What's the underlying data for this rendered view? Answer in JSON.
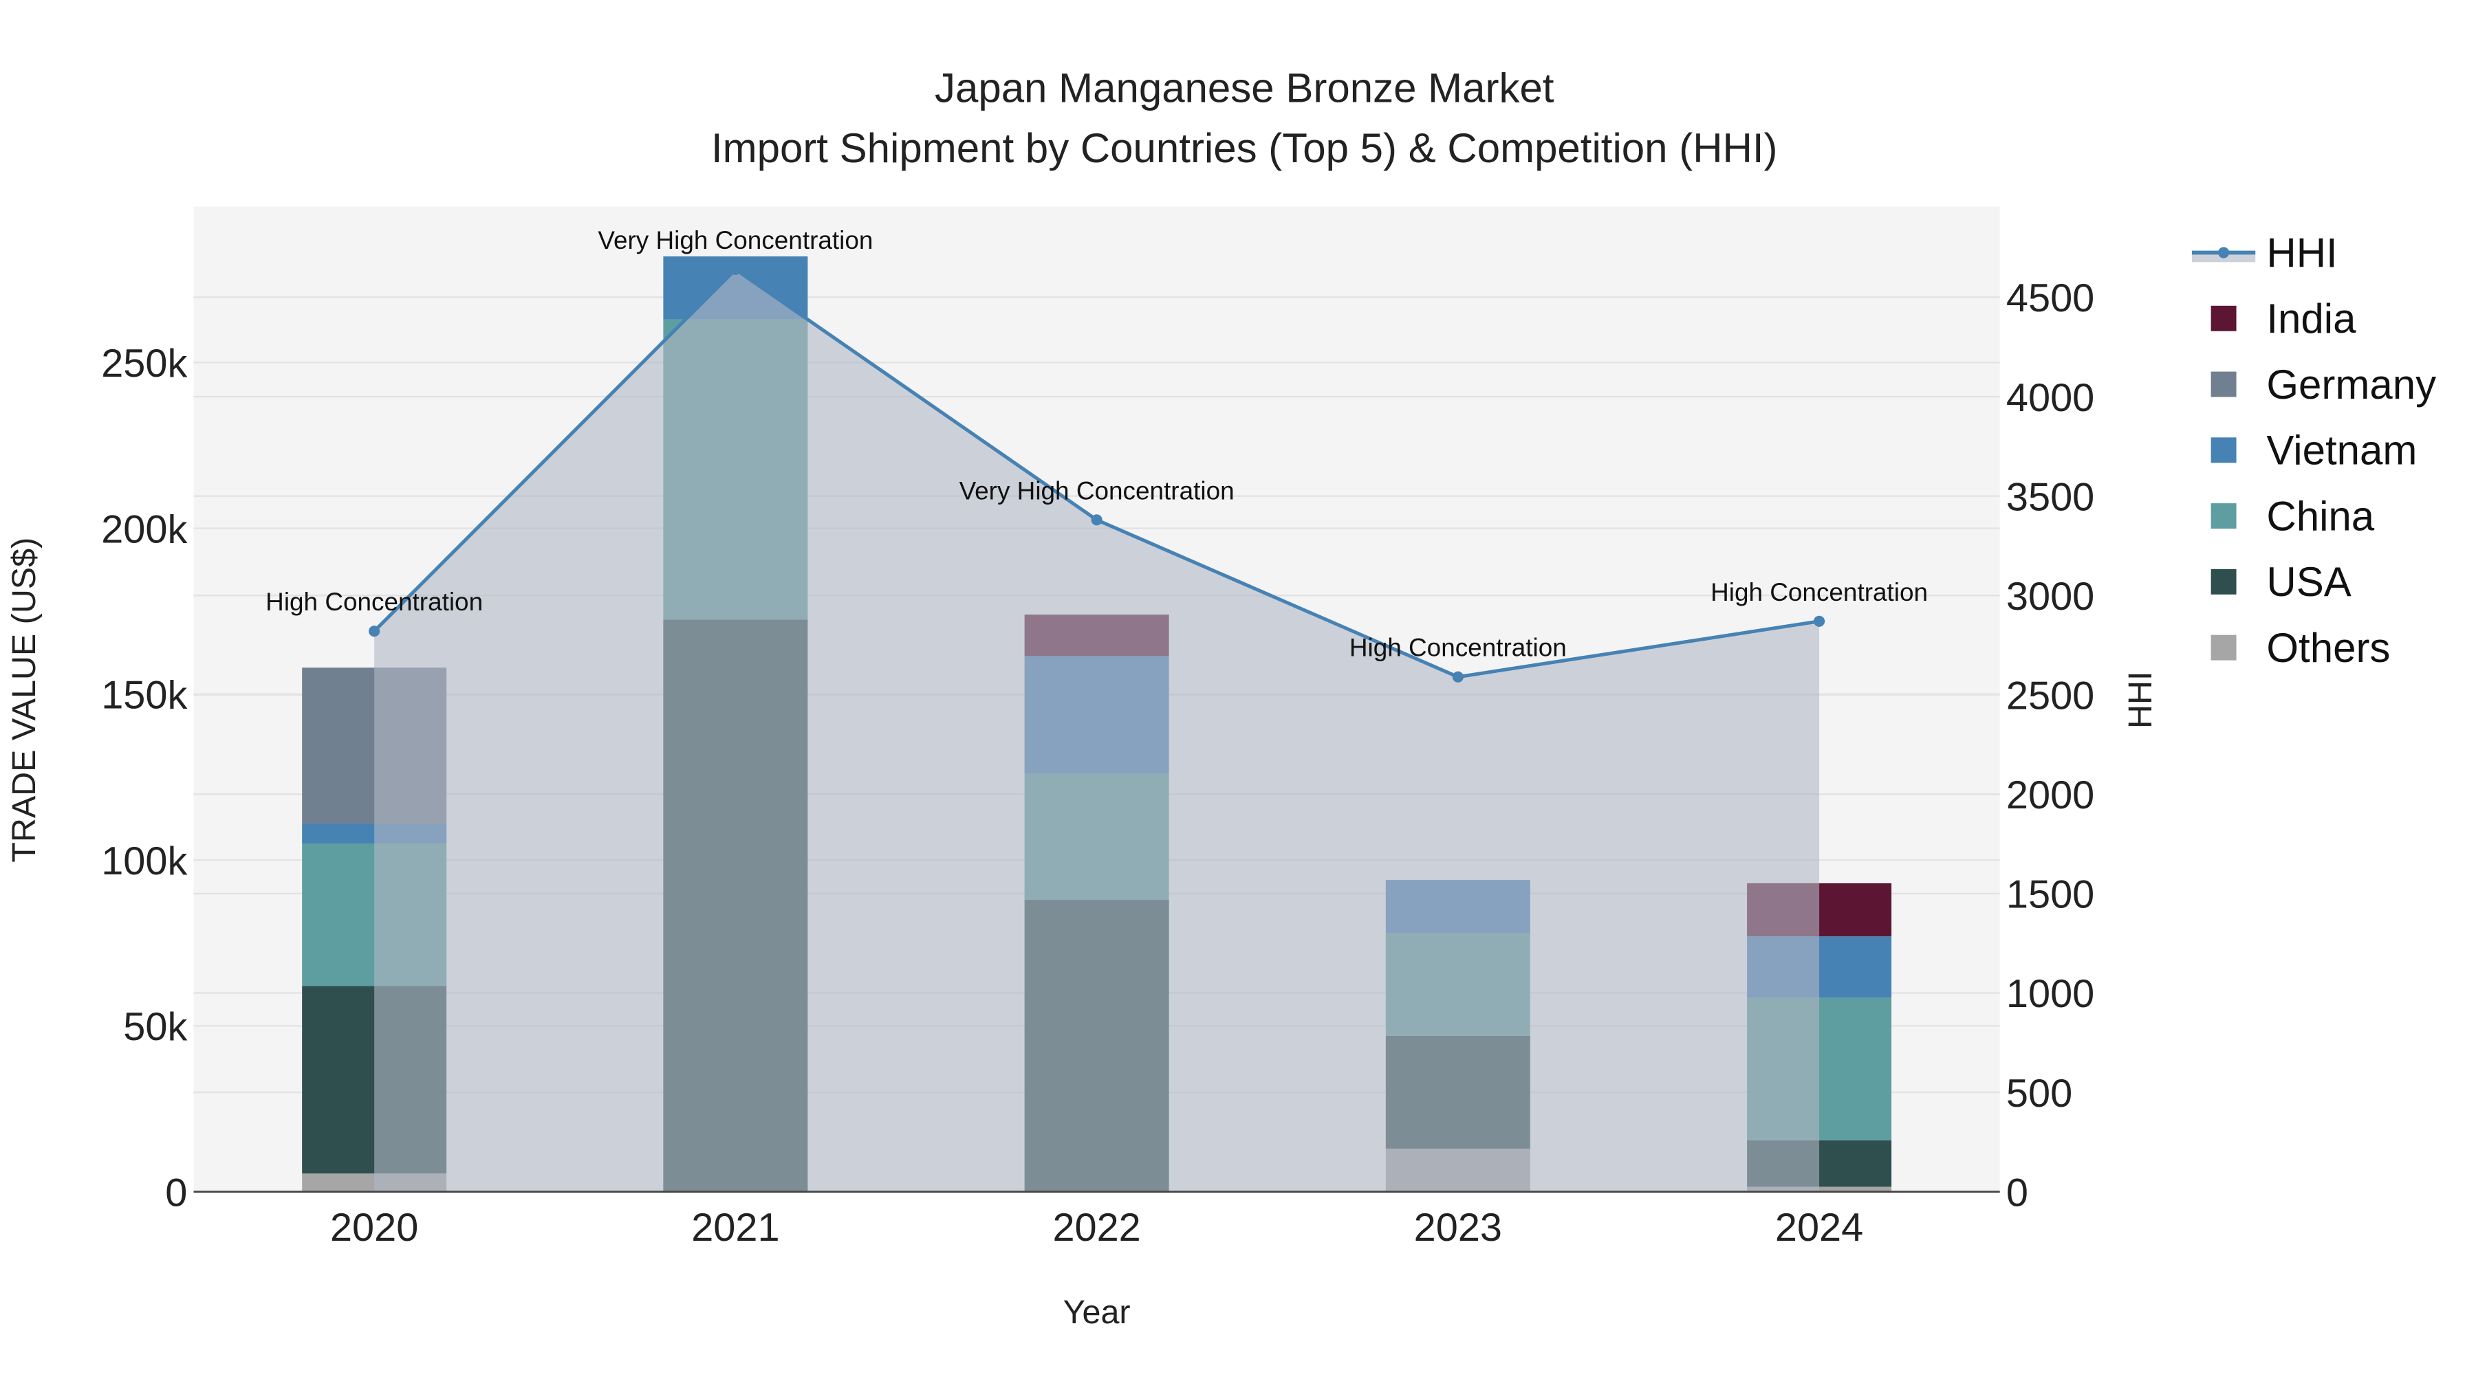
{
  "chart_data": {
    "type": "bar",
    "stacked": true,
    "title_line1": "Japan Manganese Bronze Market",
    "title_line2": "Import Shipment by Countries (Top 5) & Competition (HHI)",
    "xlabel": "Year",
    "ylabel": "TRADE VALUE (US$)",
    "y2label": "HHI",
    "categories": [
      "2020",
      "2021",
      "2022",
      "2023",
      "2024"
    ],
    "ylim": [
      0,
      297000
    ],
    "y2lim": [
      0,
      4956
    ],
    "yticks": [
      0,
      50000,
      100000,
      150000,
      200000,
      250000
    ],
    "ytick_labels": [
      "0",
      "50k",
      "100k",
      "150k",
      "200k",
      "250k"
    ],
    "y2ticks": [
      0,
      500,
      1000,
      1500,
      2000,
      2500,
      3000,
      3500,
      4000,
      4500
    ],
    "y2tick_labels": [
      "0",
      "500",
      "1000",
      "1500",
      "2000",
      "2500",
      "3000",
      "3500",
      "4000",
      "4500"
    ],
    "series": [
      {
        "name": "Others",
        "color": "#a6a6a6",
        "values": [
          5500,
          0,
          0,
          13000,
          1500
        ]
      },
      {
        "name": "USA",
        "color": "#2f4f4f",
        "values": [
          56500,
          172500,
          88000,
          34000,
          14000
        ]
      },
      {
        "name": "China",
        "color": "#5f9ea0",
        "values": [
          43000,
          90500,
          38000,
          31000,
          43000
        ]
      },
      {
        "name": "Vietnam",
        "color": "#4682b4",
        "values": [
          6000,
          19000,
          35500,
          16000,
          18500
        ]
      },
      {
        "name": "Germany",
        "color": "#708090",
        "values": [
          47000,
          0,
          0,
          0,
          0
        ]
      },
      {
        "name": "India",
        "color": "#5c1634",
        "values": [
          0,
          0,
          12500,
          0,
          16000
        ]
      }
    ],
    "hhi": {
      "name": "HHI",
      "color": "#4682b4",
      "values": [
        2820,
        4640,
        3380,
        2590,
        2870
      ],
      "annotations": [
        "High Concentration",
        "Very High Concentration",
        "Very High Concentration",
        "High Concentration",
        "High Concentration"
      ]
    },
    "legend_order": [
      "HHI",
      "India",
      "Germany",
      "Vietnam",
      "China",
      "USA",
      "Others"
    ],
    "legend_position": "right"
  }
}
